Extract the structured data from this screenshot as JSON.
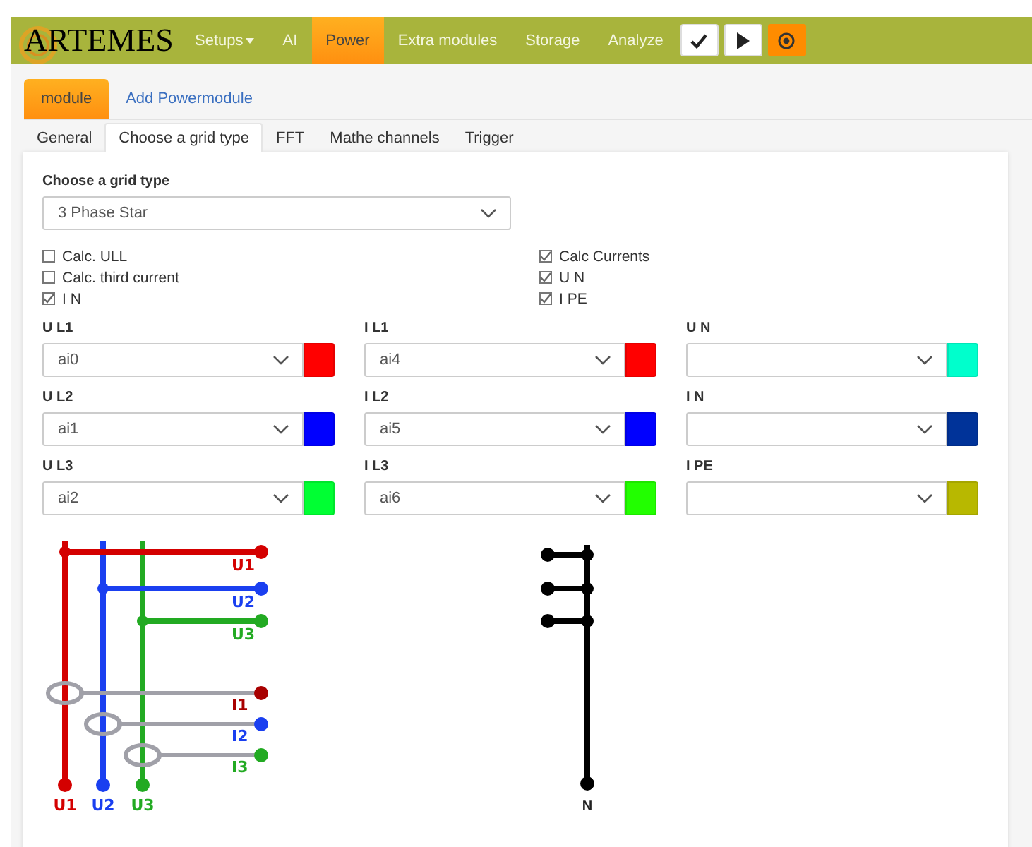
{
  "navbar": {
    "logo": "ARTEMES",
    "items": [
      {
        "label": "Setups",
        "dropdown": true,
        "selected": false
      },
      {
        "label": "AI",
        "dropdown": false,
        "selected": false
      },
      {
        "label": "Power",
        "dropdown": false,
        "selected": true
      },
      {
        "label": "Extra modules",
        "dropdown": false,
        "selected": false
      },
      {
        "label": "Storage",
        "dropdown": false,
        "selected": false
      },
      {
        "label": "Analyze",
        "dropdown": false,
        "selected": false
      }
    ],
    "buttons": [
      {
        "kind": "check",
        "highlighted": false
      },
      {
        "kind": "play",
        "highlighted": false
      },
      {
        "kind": "record",
        "highlighted": true
      }
    ]
  },
  "module_tabs": [
    {
      "label": "module",
      "selected": true
    },
    {
      "label": "Add Powermodule",
      "selected": false
    }
  ],
  "tabs": [
    {
      "label": "General",
      "selected": false
    },
    {
      "label": "Choose a grid type",
      "selected": true
    },
    {
      "label": "FFT",
      "selected": false
    },
    {
      "label": "Mathe channels",
      "selected": false
    },
    {
      "label": "Trigger",
      "selected": false
    }
  ],
  "grid_type": {
    "label": "Choose a grid type",
    "value": "3 Phase Star"
  },
  "options": [
    {
      "label": "Calc. ULL",
      "checked": false
    },
    {
      "label": "Calc Currents",
      "checked": true
    },
    {
      "label": "Calc. third current",
      "checked": false
    },
    {
      "label": "U N",
      "checked": true
    },
    {
      "label": "I N",
      "checked": true
    },
    {
      "label": "I PE",
      "checked": true
    }
  ],
  "channels": [
    {
      "label": "U L1",
      "value": "ai0",
      "color": "#ff0000"
    },
    {
      "label": "I L1",
      "value": "ai4",
      "color": "#ff0000"
    },
    {
      "label": "U N",
      "color": "#00ffcc"
    },
    {
      "label": "U L2",
      "value": "ai1",
      "color": "#0000ff"
    },
    {
      "label": "I L2",
      "value": "ai5",
      "color": "#0000ff"
    },
    {
      "label": "I N",
      "color": "#003399"
    },
    {
      "label": "U L3",
      "value": "ai2",
      "color": "#00ff33"
    },
    {
      "label": "I L3",
      "value": "ai6",
      "color": "#22ff00"
    },
    {
      "label": "I PE",
      "color": "#b8b800"
    }
  ],
  "diagram": {
    "phase_labels": [
      "U1",
      "U2",
      "U3"
    ],
    "current_labels": [
      "I1",
      "I2",
      "I3"
    ],
    "bottom_labels": [
      "U1",
      "U2",
      "U3"
    ],
    "neutral_label": "N"
  }
}
